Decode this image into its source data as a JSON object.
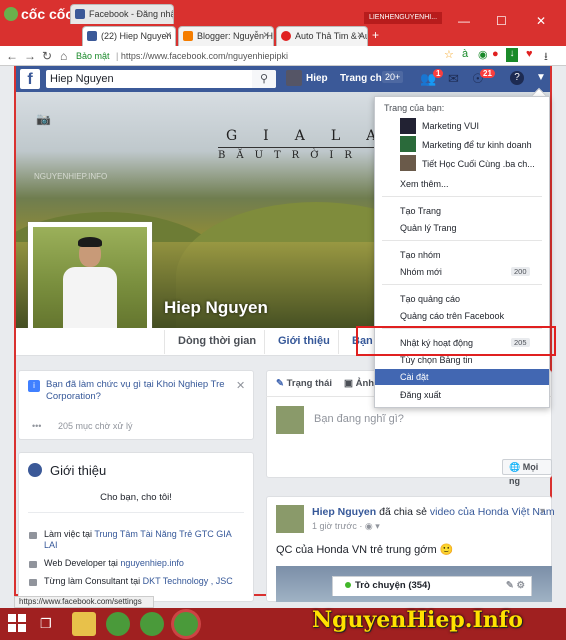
{
  "browser": {
    "brand": "cốc cốc",
    "tabs": [
      {
        "label": "(22) Hiep Nguyen",
        "color": "#3b5998"
      },
      {
        "label": "Blogger: Nguyễn Hi...",
        "color": "#f57d00"
      },
      {
        "label": "Auto Thả Tim & Auto...",
        "color": "#e02020"
      }
    ],
    "hidden_tab": "Facebook - Đăng nhập ho...",
    "user_badge": "LIENHENGUYENHI...",
    "security_label": "Bảo mật",
    "url": "https://www.facebook.com/nguyenhiepipki",
    "status_url": "https://www.facebook.com/settings"
  },
  "fb_header": {
    "search_value": "Hiep Nguyen",
    "user_name": "Hiep",
    "home_label": "Trang chủ",
    "home_count": "20+",
    "friend_badge": "1",
    "notif_badge": "21"
  },
  "cover": {
    "title": "GIALA",
    "subtitle": "BĂUTRỜIR",
    "watermark": "NGUYENHIEP.INFO"
  },
  "profile": {
    "name": "Hiep Nguyen"
  },
  "timeline_tabs": [
    "Dòng thời gian",
    "Giới thiệu",
    "Bạn b"
  ],
  "notice": {
    "text": "Bạn đã làm chức vụ gì tại Khoi Nghiep Tre Corporation?",
    "pending_dots": "•••",
    "pending": "205 mục chờ xử lý"
  },
  "intro": {
    "title": "Giới thiệu",
    "bio": "Cho bạn, cho tôi!",
    "rows": [
      {
        "prefix": "Làm việc tại ",
        "link": "Trung Tâm Tài Năng Trẻ GTC GIA LAI"
      },
      {
        "prefix": "Web Developer tại ",
        "link": "nguyenhiep.info"
      },
      {
        "prefix": "Từng làm Consultant tại ",
        "link": "DKT Technology , JSC"
      }
    ]
  },
  "composer": {
    "tab_status": "Trạng thái",
    "tab_photo": "Ảnh",
    "placeholder": "Bạn đang nghĩ gì?",
    "more_button": "Mọi ng"
  },
  "post": {
    "author": "Hiep Nguyen",
    "action": " đã chia sẻ ",
    "link": "video của Honda Việt Nam",
    "time": "1 giờ trước · ",
    "text": "QC của Honda VN trẻ trung gớm 🙂"
  },
  "chat": {
    "label": "Trò chuyện (354)"
  },
  "dropdown": {
    "pages_header": "Trang của bạn:",
    "pages": [
      "Marketing VUI",
      "Marketing để tư kinh doanh",
      "Tiết Học Cuối Cùng .ba ch..."
    ],
    "see_more": "Xem thêm...",
    "group1": [
      "Tạo Trang",
      "Quản lý Trang"
    ],
    "group2": [
      "Tạo nhóm",
      "Nhóm mới"
    ],
    "group2_count": "200",
    "group3": [
      "Tạo quảng cáo",
      "Quảng cáo trên Facebook"
    ],
    "activity_log": "Nhật ký hoạt động",
    "activity_count": "205",
    "news_feed_prefs": "Tùy chọn Bảng tin",
    "settings": "Cài đặt",
    "logout": "Đăng xuất"
  },
  "taskbar": {
    "brand": "NguyenHiep.Info"
  },
  "colors": {
    "browser_red": "#d9312f",
    "fb_blue": "#3b5998",
    "highlight": "#4267b2",
    "brand_yellow": "#ffe100"
  }
}
